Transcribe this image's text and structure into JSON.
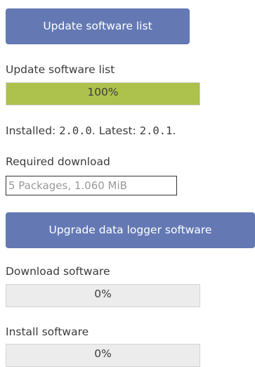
{
  "update_list_button": {
    "label": "Update software list"
  },
  "update_list": {
    "label": "Update software list",
    "progress_text": "100%",
    "progress_fraction": 1.0
  },
  "versions": {
    "installed_prefix": "Installed: ",
    "installed": "2.0.0",
    "separator": ". Latest: ",
    "latest": "2.0.1",
    "suffix": "."
  },
  "required_download": {
    "label": "Required download",
    "value": "5 Packages, 1.060 MiB"
  },
  "upgrade_button": {
    "label": "Upgrade data logger software"
  },
  "download_software": {
    "label": "Download software",
    "progress_text": "0%",
    "progress_fraction": 0
  },
  "install_software": {
    "label": "Install software",
    "progress_text": "0%",
    "progress_fraction": 0
  },
  "colors": {
    "button": "#6479b4",
    "progress_fill": "#adc14d",
    "progress_track": "#ececec"
  }
}
